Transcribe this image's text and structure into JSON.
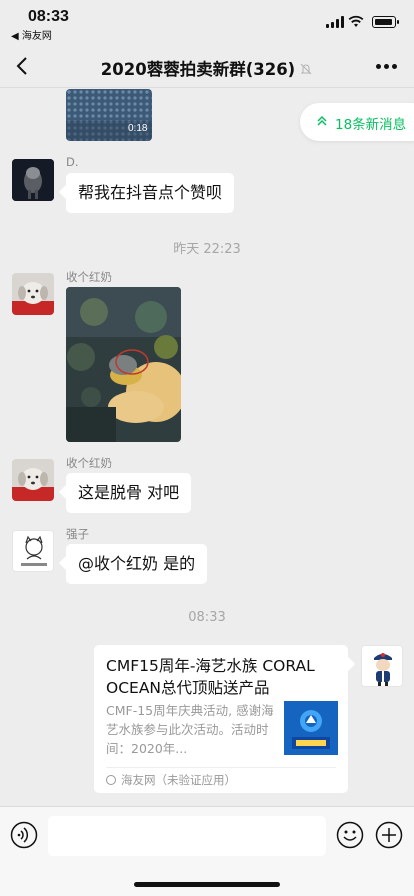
{
  "status_bar": {
    "time": "08:33",
    "back_app": "◀ 海友网"
  },
  "nav": {
    "title": "2020蓉蓉拍卖新群(326)"
  },
  "new_messages": {
    "label": "18条新消息"
  },
  "messages": [
    {
      "type": "image",
      "sender": "",
      "watermark": "0:18"
    },
    {
      "type": "text",
      "sender": "D.",
      "text": "帮我在抖音点个赞呗"
    },
    {
      "type": "timestamp",
      "text": "昨天 22:23"
    },
    {
      "type": "image",
      "sender": "收个红奶"
    },
    {
      "type": "text",
      "sender": "收个红奶",
      "text": "这是脱骨  对吧"
    },
    {
      "type": "text",
      "sender": "强子",
      "text": "@收个红奶  是的"
    },
    {
      "type": "timestamp",
      "text": "08:33"
    },
    {
      "type": "link_card",
      "title": "CMF15周年-海艺水族 CORAL OCEAN总代顶贴送产品",
      "description": "CMF-15周年庆典活动, 感谢海艺水族参与此次活动。活动时间：2020年...",
      "source": "海友网（未验证应用）"
    }
  ],
  "input_bar": {
    "value": ""
  },
  "icons": [
    "back-icon",
    "mute-icon",
    "more-icon",
    "voice-icon",
    "emoji-icon",
    "plus-icon",
    "double-chevron-up-icon"
  ],
  "colors": {
    "accent": "#07c160",
    "background": "#ededed",
    "bubble": "#ffffff"
  }
}
